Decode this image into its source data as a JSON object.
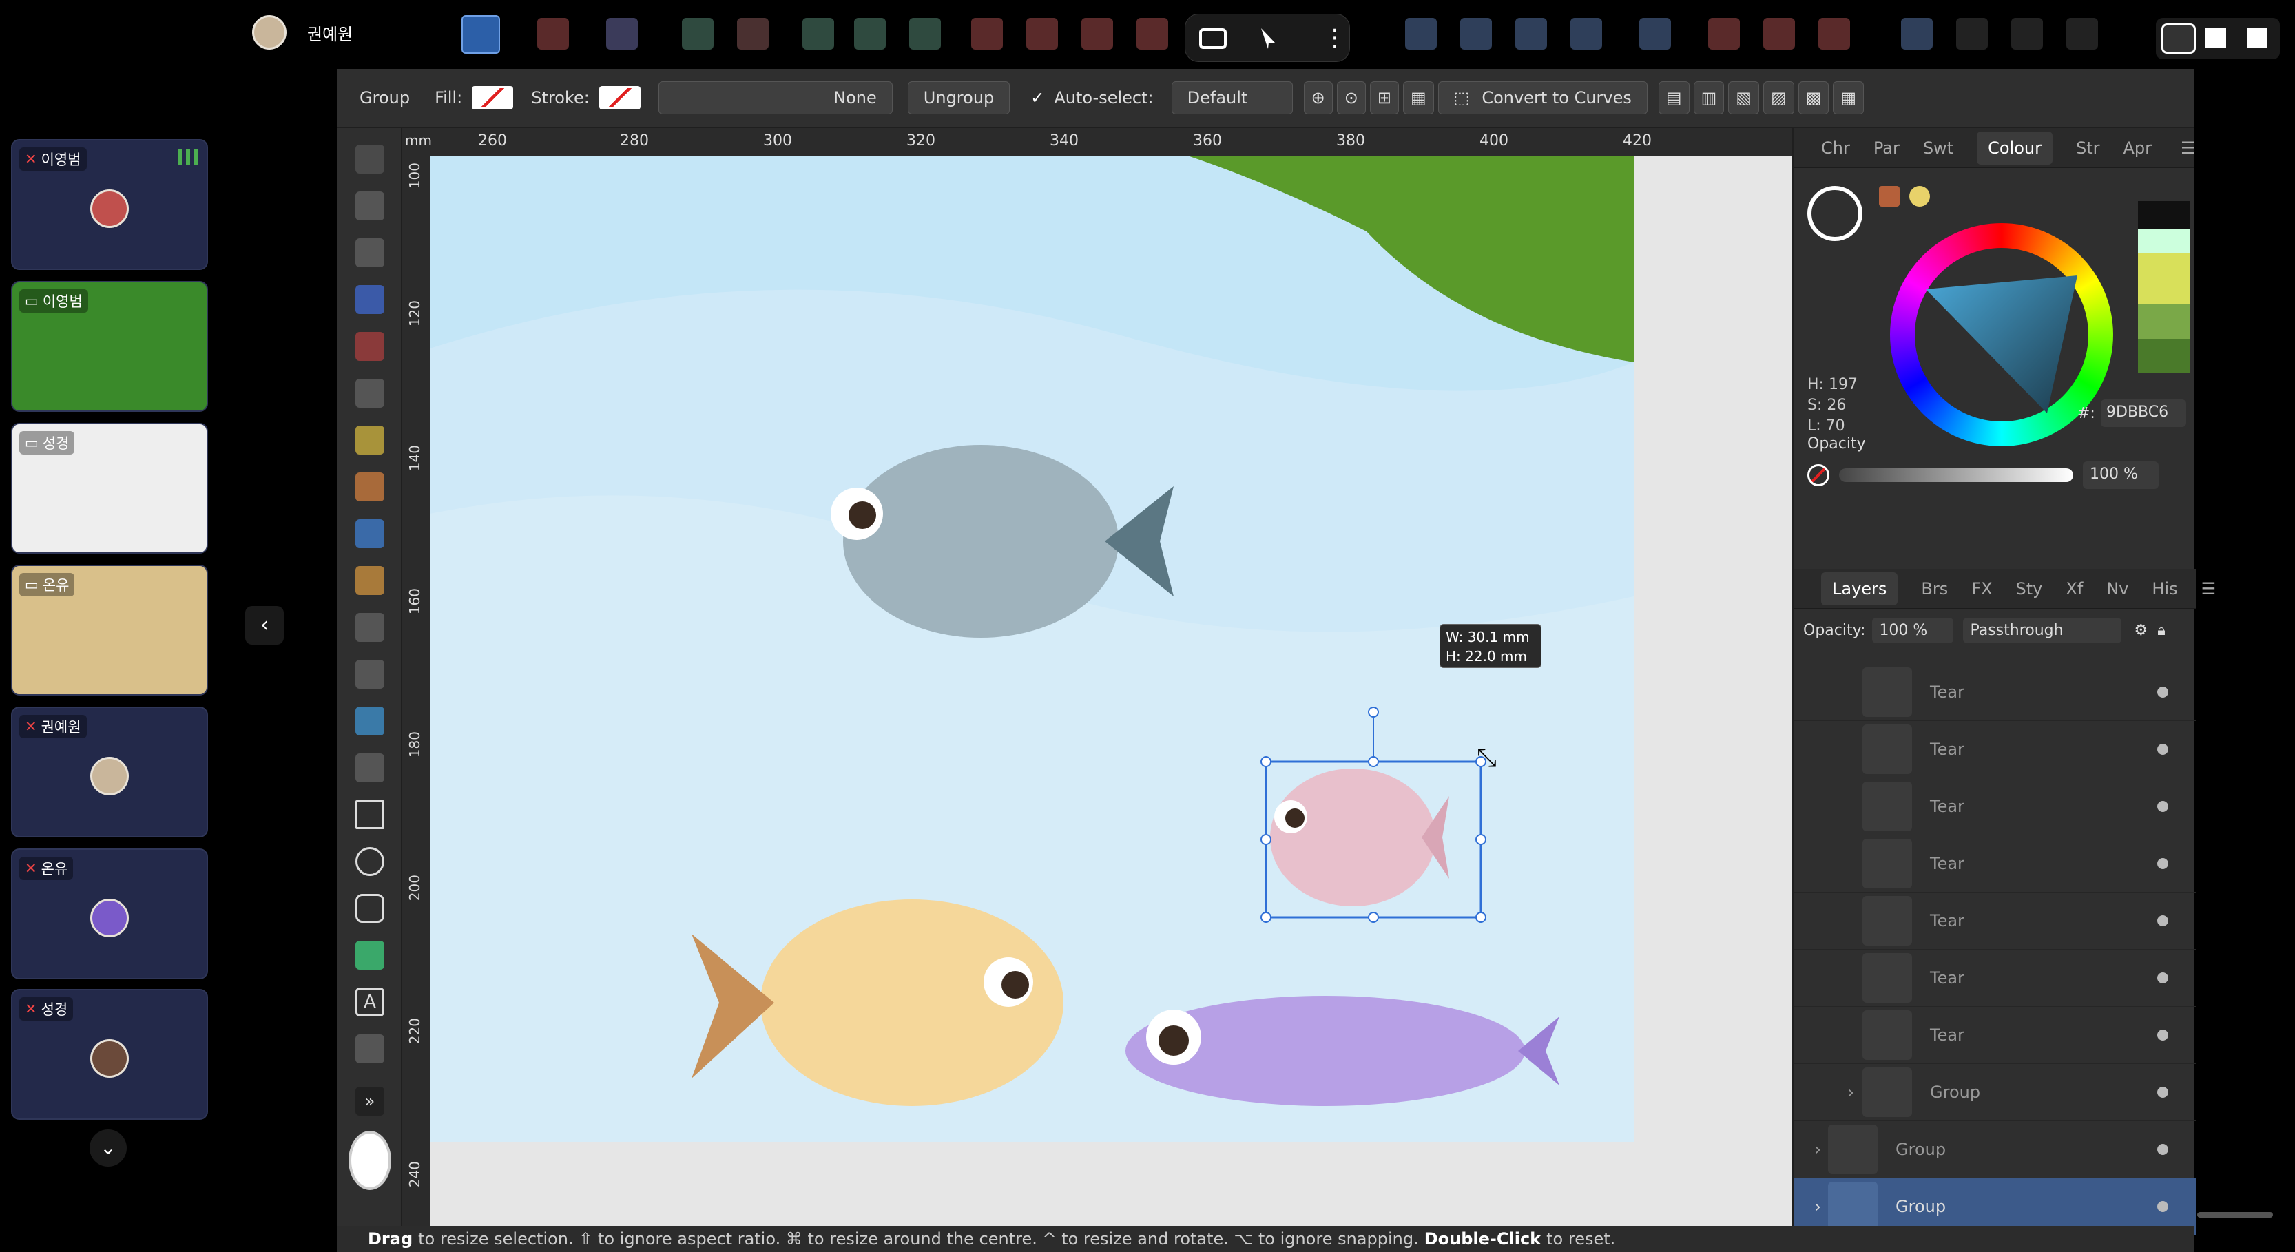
{
  "meeting": {
    "self_name": "권예원",
    "participants": [
      {
        "name": "이영범",
        "type": "cam-off"
      },
      {
        "name": "이영범",
        "type": "screen"
      },
      {
        "name": "성경",
        "type": "screen"
      },
      {
        "name": "온유",
        "type": "screen"
      },
      {
        "name": "권예원",
        "type": "cam-off"
      },
      {
        "name": "온유",
        "type": "cam-off"
      },
      {
        "name": "성경",
        "type": "cam-off"
      }
    ]
  },
  "context_toolbar": {
    "selection": "Group",
    "fill_label": "Fill:",
    "stroke_label": "Stroke:",
    "stroke_style": "None",
    "ungroup": "Ungroup",
    "auto_select_label": "Auto-select:",
    "auto_select_value": "Default",
    "convert": "Convert to Curves"
  },
  "ruler": {
    "unit": "mm",
    "top_ticks": [
      "260",
      "280",
      "300",
      "320",
      "340",
      "360",
      "380",
      "400",
      "420"
    ],
    "left_ticks": [
      "100",
      "120",
      "140",
      "160",
      "180",
      "200",
      "220",
      "240"
    ]
  },
  "tooltip": {
    "w": "W: 30.1 mm",
    "h": "H: 22.0 mm"
  },
  "colour_panel": {
    "tabs": [
      "Chr",
      "Par",
      "Swt",
      "Colour",
      "Str",
      "Apr"
    ],
    "active_tab": "Colour",
    "h": "H: 197",
    "s": "S: 26",
    "l": "L: 70",
    "hex_label": "#:",
    "hex": "9DBBC6",
    "opacity_label": "Opacity",
    "opacity": "100 %"
  },
  "layers_panel": {
    "tabs": [
      "Layers",
      "Brs",
      "FX",
      "Sty",
      "Xf",
      "Nv",
      "His"
    ],
    "active_tab": "Layers",
    "opacity_label": "Opacity:",
    "opacity": "100 %",
    "blend": "Passthrough",
    "rows": [
      {
        "name": "Tear"
      },
      {
        "name": "Tear"
      },
      {
        "name": "Tear"
      },
      {
        "name": "Tear"
      },
      {
        "name": "Tear"
      },
      {
        "name": "Tear"
      },
      {
        "name": "Tear"
      },
      {
        "name": "Group"
      },
      {
        "name": "Group"
      },
      {
        "name": "Group",
        "selected": true
      }
    ]
  },
  "status_bar": {
    "drag": "Drag",
    "text1": "to resize selection. ⇧ to ignore aspect ratio. ⌘ to resize around the centre. ^ to resize and rotate. ⌥ to ignore snapping.",
    "dbl": "Double-Click",
    "text2": "to reset."
  },
  "colors": {
    "accent": "#3b6fd6",
    "sky": "#c4e6f7",
    "selection": "#2f6fd6"
  }
}
